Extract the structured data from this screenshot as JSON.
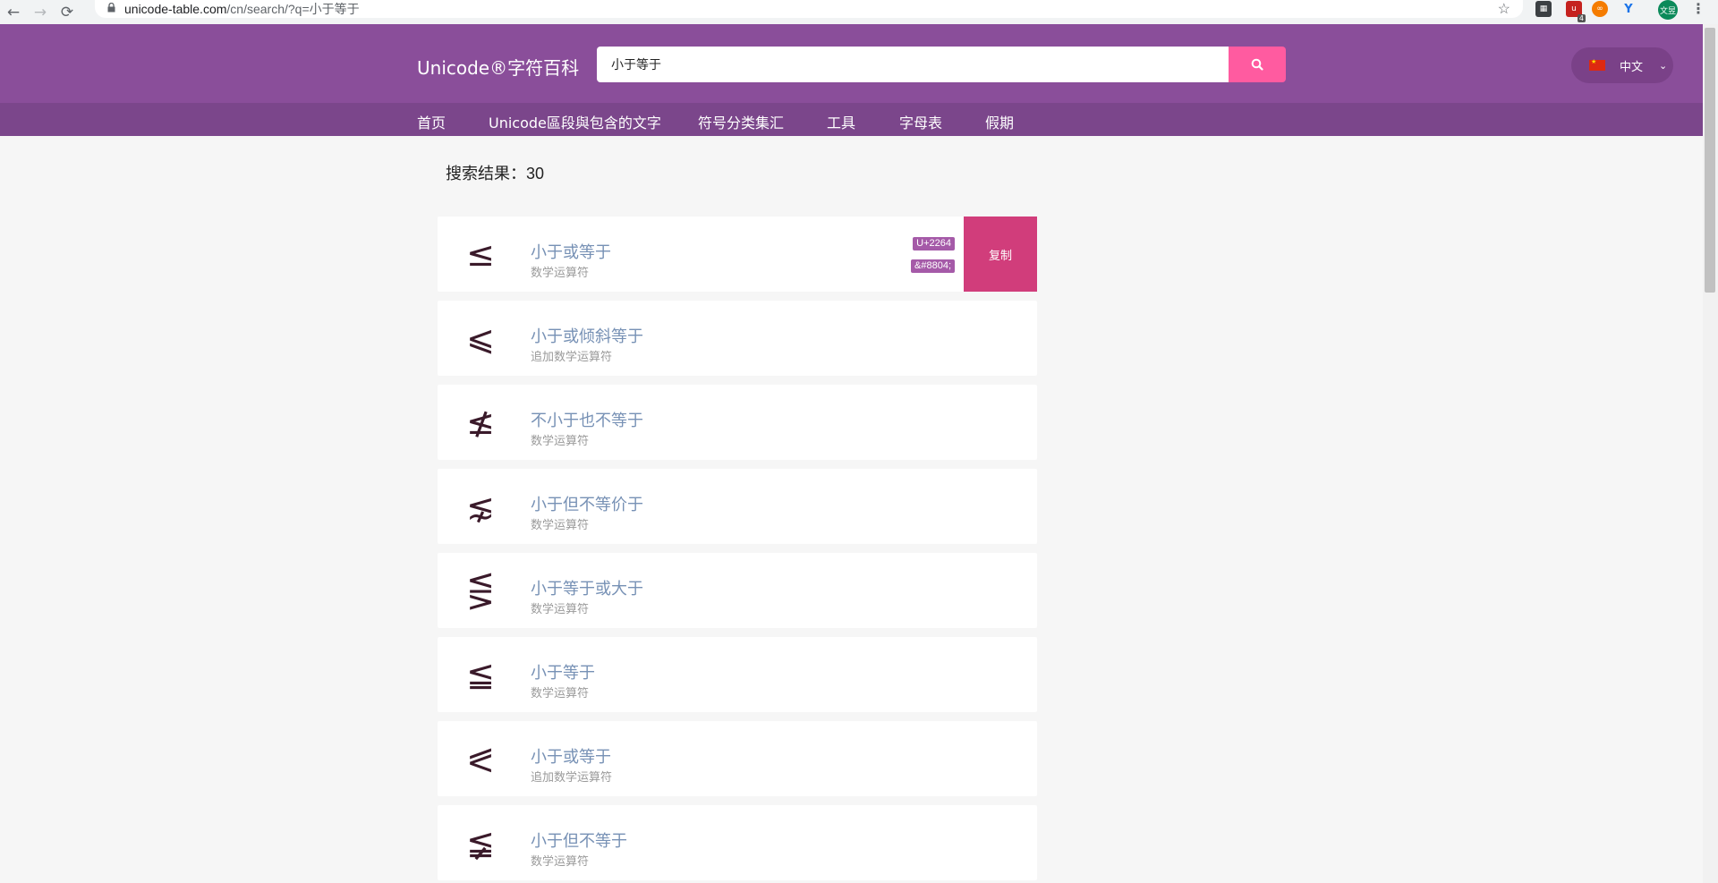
{
  "browser": {
    "url_host": "unicode-table.com",
    "url_path": "/cn/search/?q=小于等于",
    "back_icon": "←",
    "forward_icon": "→",
    "reload_icon": "⟳",
    "lock_icon": "🔒",
    "star_icon": "☆",
    "extension_badge": "4",
    "avatar_text": "文昱",
    "menu_icon": "⋮"
  },
  "header": {
    "logo": "Unicode®字符百科",
    "search_value": "小于等于",
    "search_icon": "search-icon",
    "language_label": "中文",
    "language_caret": "⌄",
    "brand_color": "#8a4e9a",
    "accent_color": "#ff5ba0"
  },
  "nav": {
    "items": [
      {
        "label": "首页"
      },
      {
        "label": "Unicode區段與包含的文字"
      },
      {
        "label": "符号分类集汇"
      },
      {
        "label": "工具"
      },
      {
        "label": "字母表"
      },
      {
        "label": "假期"
      }
    ]
  },
  "results": {
    "label": "搜索结果：",
    "count": "30",
    "items": [
      {
        "glyph": "≤",
        "name": "小于或等于",
        "category": "数学运算符",
        "code": "U+2264",
        "entity": "&#8804;",
        "copy_label": "复制"
      },
      {
        "glyph": "⩽",
        "name": "小于或倾斜等于",
        "category": "追加数学运算符"
      },
      {
        "glyph": "≰",
        "name": "不小于也不等于",
        "category": "数学运算符"
      },
      {
        "glyph": "⋦",
        "name": "小于但不等价于",
        "category": "数学运算符"
      },
      {
        "glyph": "⋚",
        "name": "小于等于或大于",
        "category": "数学运算符"
      },
      {
        "glyph": "≦",
        "name": "小于等于",
        "category": "数学运算符"
      },
      {
        "glyph": "⪕",
        "name": "小于或等于",
        "category": "追加数学运算符"
      },
      {
        "glyph": "≨",
        "name": "小于但不等于",
        "category": "数学运算符"
      }
    ]
  }
}
